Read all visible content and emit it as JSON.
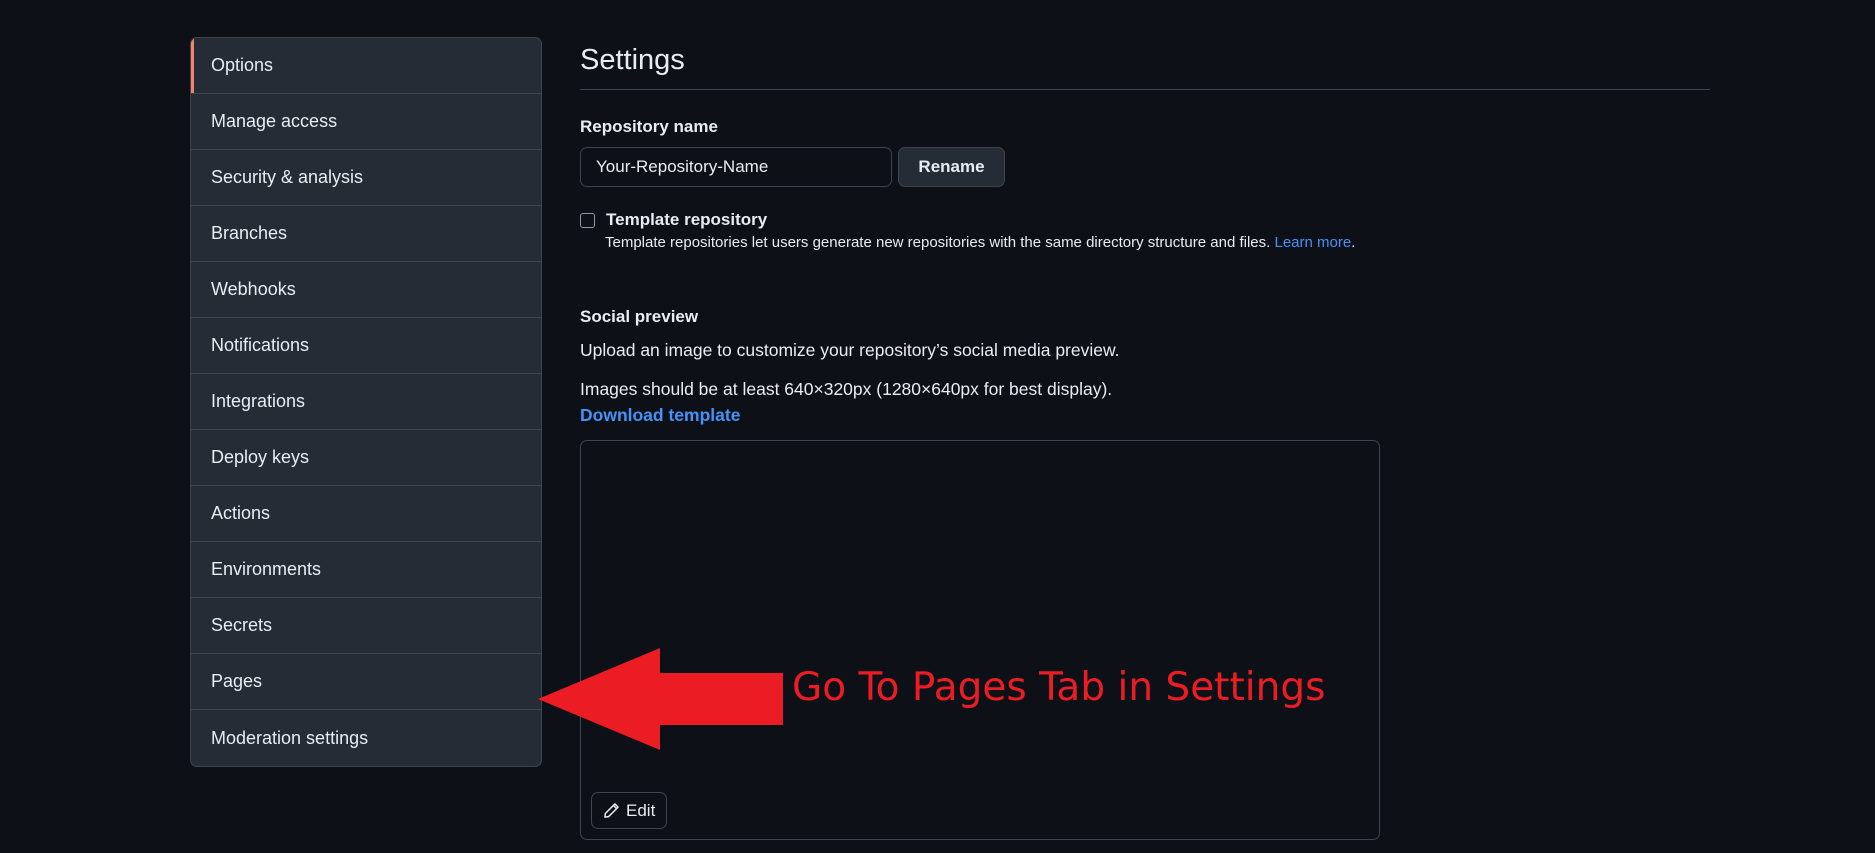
{
  "sidebar": {
    "items": [
      {
        "label": "Options",
        "selected": true
      },
      {
        "label": "Manage access"
      },
      {
        "label": "Security & analysis"
      },
      {
        "label": "Branches"
      },
      {
        "label": "Webhooks"
      },
      {
        "label": "Notifications"
      },
      {
        "label": "Integrations"
      },
      {
        "label": "Deploy keys"
      },
      {
        "label": "Actions"
      },
      {
        "label": "Environments"
      },
      {
        "label": "Secrets"
      },
      {
        "label": "Pages"
      },
      {
        "label": "Moderation settings"
      }
    ]
  },
  "main": {
    "title": "Settings",
    "repo_name_label": "Repository name",
    "repo_name_value": "Your-Repository-Name",
    "rename_label": "Rename",
    "template_label": "Template repository",
    "template_desc": "Template repositories let users generate new repositories with the same directory structure and files.",
    "learn_more": "Learn more",
    "template_desc_end": ".",
    "social_label": "Social preview",
    "upload_text": "Upload an image to customize your repository’s social media preview.",
    "size_text": "Images should be at least 640×320px (1280×640px for best display).",
    "download_template": "Download template",
    "edit_label": "Edit"
  },
  "annotation": {
    "text": "Go To Pages Tab in Settings",
    "color": "#ec1c24"
  },
  "colors": {
    "background": "#0d1117",
    "sidebar_bg": "#262c36",
    "link": "#4493f8",
    "selected_accent": "#f78166"
  }
}
